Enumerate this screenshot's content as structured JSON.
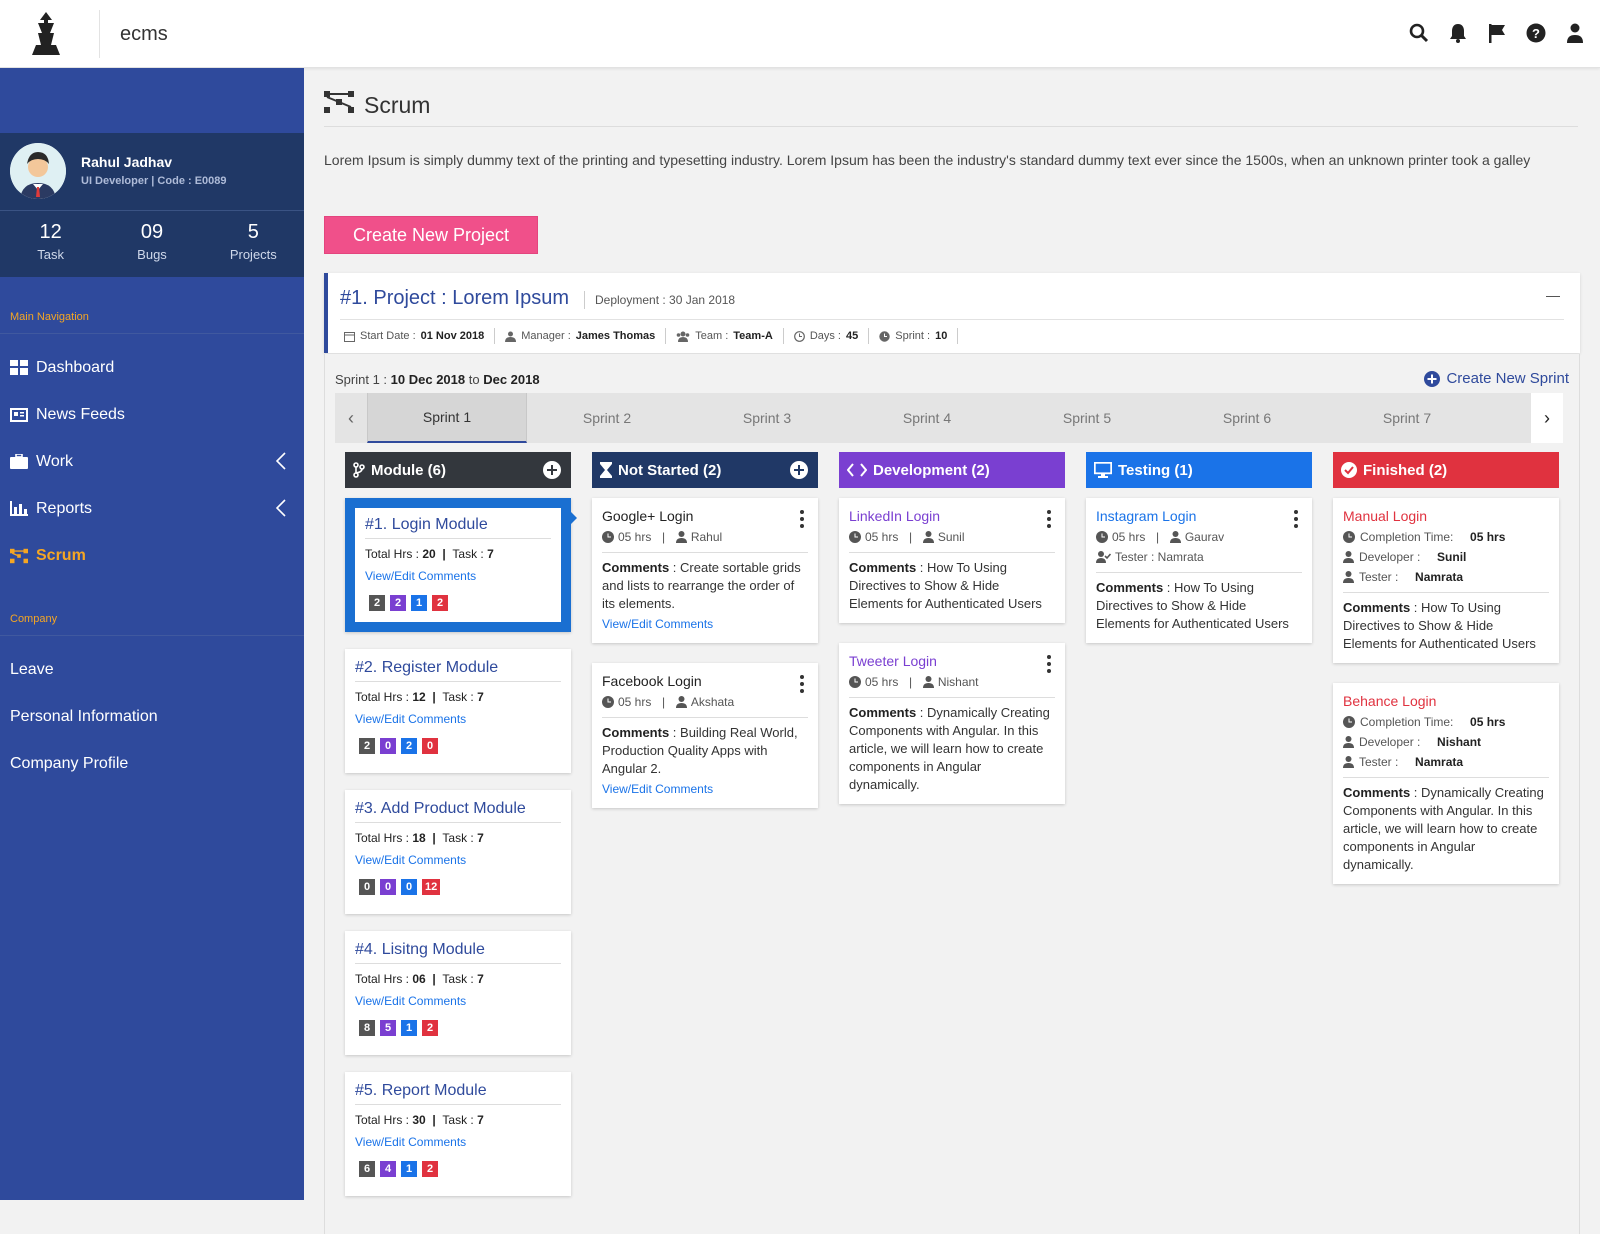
{
  "app": {
    "name": "ecms"
  },
  "topbar": {
    "icons": [
      "search-icon",
      "bell-icon",
      "flag-icon",
      "help-icon",
      "user-icon"
    ]
  },
  "profile": {
    "name": "Rahul Jadhav",
    "role": "UI Developer  |  Code : E0089"
  },
  "stats": [
    {
      "value": "12",
      "label": "Task"
    },
    {
      "value": "09",
      "label": "Bugs"
    },
    {
      "value": "5",
      "label": "Projects"
    }
  ],
  "nav": {
    "main_heading": "Main Navigation",
    "items": [
      {
        "label": "Dashboard"
      },
      {
        "label": "News Feeds"
      },
      {
        "label": "Work"
      },
      {
        "label": "Reports"
      },
      {
        "label": "Scrum"
      }
    ],
    "company_heading": "Company",
    "company_items": [
      {
        "label": "Leave"
      },
      {
        "label": "Personal Information"
      },
      {
        "label": "Company Profile"
      }
    ]
  },
  "page": {
    "title": "Scrum",
    "description": "Lorem Ipsum is simply dummy text of the printing and typesetting industry. Lorem Ipsum has been the industry's standard dummy text ever since the 1500s, when an unknown printer took a galley",
    "create_project": "Create New Project"
  },
  "project": {
    "title": "#1. Project : Lorem Ipsum",
    "deployment": "Deployment : 30 Jan 2018",
    "start_label": "Start Date :",
    "start_value": "01 Nov 2018",
    "manager_label": "Manager :",
    "manager_value": "James Thomas",
    "team_label": "Team :",
    "team_value": "Team-A",
    "days_label": "Days :",
    "days_value": "45",
    "sprint_label": "Sprint :",
    "sprint_value": "10"
  },
  "sprint": {
    "prefix": "Sprint 1 :",
    "start": "10 Dec 2018",
    "to": "to",
    "end": "Dec 2018",
    "create": "Create New Sprint",
    "tabs": [
      "Sprint 1",
      "Sprint 2",
      "Sprint 3",
      "Sprint 4",
      "Sprint 5",
      "Sprint 6",
      "Sprint 7"
    ]
  },
  "columns": {
    "module": {
      "title": "Module (6)",
      "color": "#33373d"
    },
    "not_started": {
      "title": "Not Started (2)",
      "color": "#203866"
    },
    "development": {
      "title": "Development (2)",
      "color": "#7a3fd1"
    },
    "testing": {
      "title": "Testing (1)",
      "color": "#1a73e8"
    },
    "finished": {
      "title": "Finished (2)",
      "color": "#e0323f"
    }
  },
  "badge_colors": [
    "#555555",
    "#7a3fd1",
    "#1a73e8",
    "#e0323f"
  ],
  "modules": [
    {
      "title": "#1. Login Module",
      "hrs_label": "Total Hrs :",
      "hrs": "20",
      "task_label": "Task :",
      "task": "7",
      "link": "View/Edit Comments",
      "badges": [
        "2",
        "2",
        "1",
        "2"
      ]
    },
    {
      "title": "#2. Register Module",
      "hrs_label": "Total Hrs :",
      "hrs": "12",
      "task_label": "Task :",
      "task": "7",
      "link": "View/Edit Comments",
      "badges": [
        "2",
        "0",
        "2",
        "0"
      ]
    },
    {
      "title": "#3. Add Product Module",
      "hrs_label": "Total Hrs :",
      "hrs": "18",
      "task_label": "Task :",
      "task": "7",
      "link": "View/Edit Comments",
      "badges": [
        "0",
        "0",
        "0",
        "12"
      ]
    },
    {
      "title": "#4. Lisitng Module",
      "hrs_label": "Total Hrs :",
      "hrs": "06",
      "task_label": "Task :",
      "task": "7",
      "link": "View/Edit Comments",
      "badges": [
        "8",
        "5",
        "1",
        "2"
      ]
    },
    {
      "title": "#5. Report Module",
      "hrs_label": "Total Hrs :",
      "hrs": "30",
      "task_label": "Task :",
      "task": "7",
      "link": "View/Edit Comments",
      "badges": [
        "6",
        "4",
        "1",
        "2"
      ]
    }
  ],
  "not_started": [
    {
      "name": "Google+ Login",
      "hrs": "05 hrs",
      "user": "Rahul",
      "comment_label": "Comments",
      "comment": " : Create sortable grids and lists to rearrange the order of its elements.",
      "link": "View/Edit Comments"
    },
    {
      "name": "Facebook Login",
      "hrs": "05 hrs",
      "user": "Akshata",
      "comment_label": "Comments",
      "comment": " : Building Real World, Production Quality Apps with Angular 2.",
      "link": "View/Edit Comments"
    }
  ],
  "development": [
    {
      "name": "LinkedIn Login",
      "hrs": "05 hrs",
      "user": "Sunil",
      "comment_label": "Comments",
      "comment": " : How To Using Directives to Show & Hide Elements for Authenticated Users"
    },
    {
      "name": "Tweeter Login",
      "hrs": "05 hrs",
      "user": "Nishant",
      "comment_label": "Comments",
      "comment": " : Dynamically Creating Components with Angular. In this article, we will learn how to create components in Angular dynamically."
    }
  ],
  "testing": [
    {
      "name": "Instagram Login",
      "hrs": "05 hrs",
      "user": "Gaurav",
      "tester": "Tester : Namrata",
      "comment_label": "Comments",
      "comment": " : How To Using Directives to Show & Hide Elements for Authenticated Users"
    }
  ],
  "finished": [
    {
      "name": "Manual Login",
      "time_label": "Completion Time:",
      "time": "05 hrs",
      "dev_label": "Developer :",
      "dev": "Sunil",
      "tester_label": "Tester :",
      "tester": "Namrata",
      "comment_label": "Comments",
      "comment": " : How To Using Directives to Show & Hide Elements for Authenticated Users"
    },
    {
      "name": "Behance Login",
      "time_label": "Completion Time:",
      "time": "05 hrs",
      "dev_label": "Developer :",
      "dev": "Nishant",
      "tester_label": "Tester :",
      "tester": "Namrata",
      "comment_label": "Comments",
      "comment": " : Dynamically Creating Components with Angular. In this article, we will learn how to create components in Angular dynamically."
    }
  ]
}
